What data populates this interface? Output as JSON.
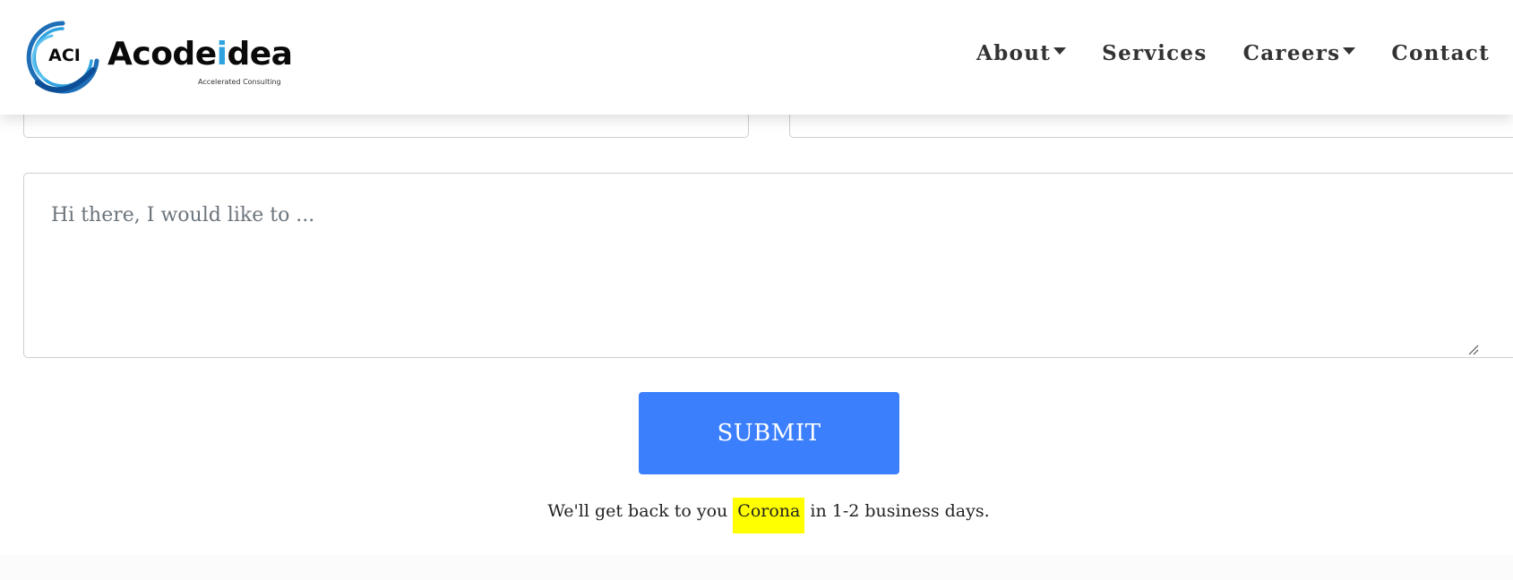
{
  "brand": {
    "mark_text": "ACI",
    "name_part1": "Acode",
    "name_i": "i",
    "name_part2": "dea",
    "tagline": "Accelerated Consulting",
    "accent_color": "#2ea3e0"
  },
  "nav": {
    "items": [
      {
        "label": "About",
        "has_dropdown": true
      },
      {
        "label": "Services",
        "has_dropdown": false
      },
      {
        "label": "Careers",
        "has_dropdown": true
      },
      {
        "label": "Contact",
        "has_dropdown": false
      }
    ]
  },
  "form": {
    "message_placeholder": "Hi there, I would like to ...",
    "submit_label": "SUBMIT",
    "submit_color": "#3b7ffd"
  },
  "note": {
    "before": "We'll get back to you ",
    "highlight": "Corona",
    "after": " in 1-2 business days.",
    "highlight_color": "#ffff00"
  }
}
